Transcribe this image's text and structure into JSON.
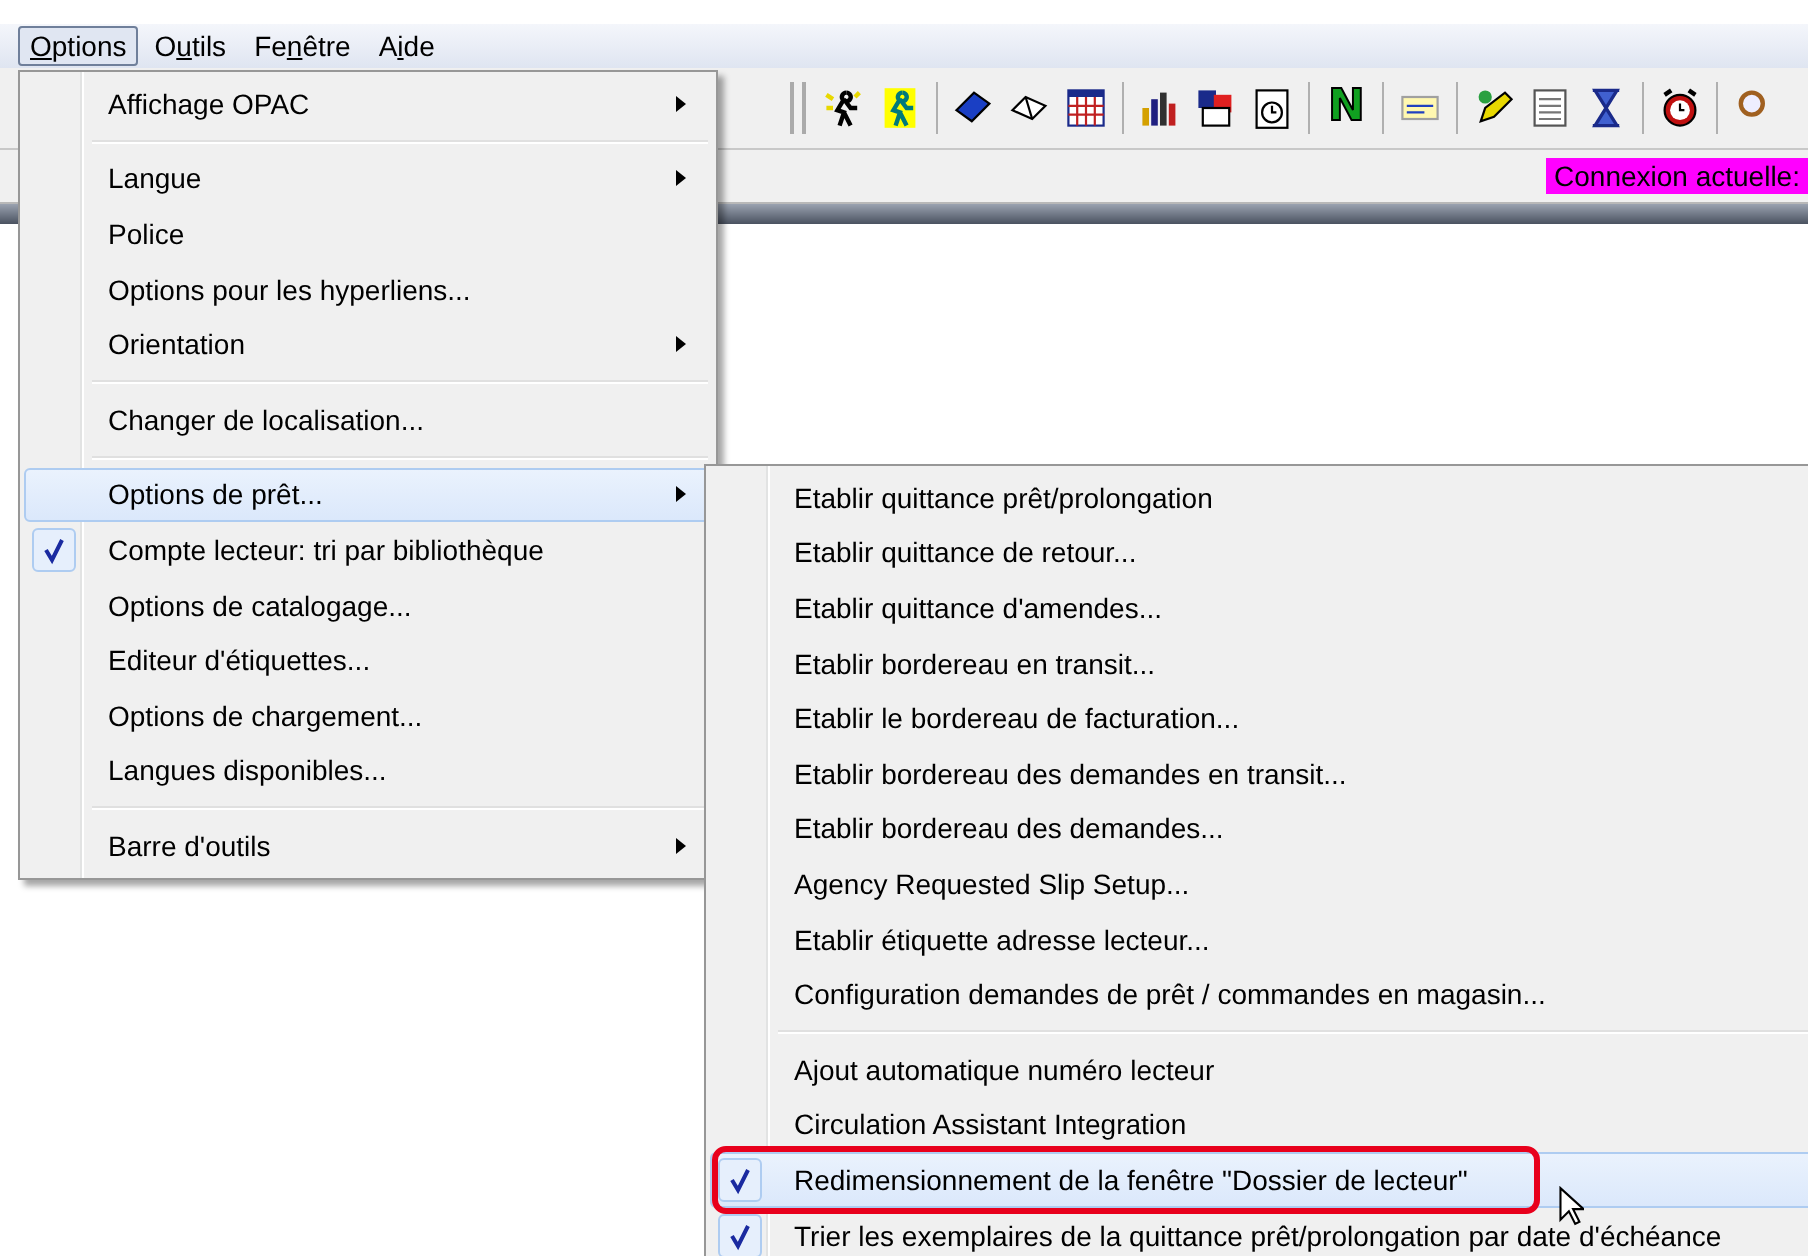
{
  "menubar": [
    {
      "access_key": "O",
      "after": "ptions",
      "selected": true
    },
    {
      "before": "O",
      "access_key": "u",
      "after": "tils",
      "selected": false
    },
    {
      "before": "Fe",
      "access_key": "n",
      "after": "être",
      "selected": false
    },
    {
      "before": "A",
      "access_key": "i",
      "after": "de",
      "selected": false
    }
  ],
  "toolbar": {
    "letter_button": "N"
  },
  "connection_label": "Connexion actuelle:",
  "options_menu": [
    {
      "kind": "item",
      "label": "Affichage OPAC",
      "submenu": true,
      "checked": false,
      "selected": false
    },
    {
      "kind": "separator"
    },
    {
      "kind": "item",
      "label": "Langue",
      "submenu": true,
      "checked": false,
      "selected": false
    },
    {
      "kind": "item",
      "label": "Police",
      "submenu": false,
      "checked": false,
      "selected": false
    },
    {
      "kind": "item",
      "label": "Options pour les hyperliens...",
      "submenu": false,
      "checked": false,
      "selected": false
    },
    {
      "kind": "item",
      "label": "Orientation",
      "submenu": true,
      "checked": false,
      "selected": false
    },
    {
      "kind": "separator"
    },
    {
      "kind": "item",
      "label": "Changer de localisation...",
      "submenu": false,
      "checked": false,
      "selected": false
    },
    {
      "kind": "separator"
    },
    {
      "kind": "item",
      "label": "Options de prêt...",
      "submenu": true,
      "checked": false,
      "selected": true
    },
    {
      "kind": "item",
      "label": "Compte lecteur: tri par bibliothèque",
      "submenu": false,
      "checked": true,
      "selected": false
    },
    {
      "kind": "item",
      "label": "Options de catalogage...",
      "submenu": false,
      "checked": false,
      "selected": false
    },
    {
      "kind": "item",
      "label": "Editeur d'étiquettes...",
      "submenu": false,
      "checked": false,
      "selected": false
    },
    {
      "kind": "item",
      "label": "Options de chargement...",
      "submenu": false,
      "checked": false,
      "selected": false
    },
    {
      "kind": "item",
      "label": "Langues disponibles...",
      "submenu": false,
      "checked": false,
      "selected": false
    },
    {
      "kind": "separator"
    },
    {
      "kind": "item",
      "label": "Barre d'outils",
      "submenu": true,
      "checked": false,
      "selected": false
    }
  ],
  "loan_submenu": [
    {
      "kind": "item",
      "label": "Etablir quittance prêt/prolongation",
      "checked": false,
      "selected": false,
      "highlighted": false
    },
    {
      "kind": "item",
      "label": "Etablir quittance de retour...",
      "checked": false,
      "selected": false,
      "highlighted": false
    },
    {
      "kind": "item",
      "label": "Etablir quittance d'amendes...",
      "checked": false,
      "selected": false,
      "highlighted": false
    },
    {
      "kind": "item",
      "label": "Etablir bordereau en transit...",
      "checked": false,
      "selected": false,
      "highlighted": false
    },
    {
      "kind": "item",
      "label": "Etablir le bordereau de facturation...",
      "checked": false,
      "selected": false,
      "highlighted": false
    },
    {
      "kind": "item",
      "label": "Etablir bordereau des demandes en transit...",
      "checked": false,
      "selected": false,
      "highlighted": false
    },
    {
      "kind": "item",
      "label": "Etablir bordereau des demandes...",
      "checked": false,
      "selected": false,
      "highlighted": false
    },
    {
      "kind": "item",
      "label": "Agency Requested Slip Setup...",
      "checked": false,
      "selected": false,
      "highlighted": false
    },
    {
      "kind": "item",
      "label": "Etablir étiquette adresse lecteur...",
      "checked": false,
      "selected": false,
      "highlighted": false
    },
    {
      "kind": "item",
      "label": "Configuration demandes de prêt / commandes en magasin...",
      "checked": false,
      "selected": false,
      "highlighted": false
    },
    {
      "kind": "separator"
    },
    {
      "kind": "item",
      "label": "Ajout automatique numéro lecteur",
      "checked": false,
      "selected": false,
      "highlighted": false
    },
    {
      "kind": "item",
      "label": "Circulation Assistant Integration",
      "checked": false,
      "selected": false,
      "highlighted": false
    },
    {
      "kind": "item",
      "label": "Redimensionnement de la fenêtre \"Dossier de lecteur\"",
      "checked": true,
      "selected": true,
      "highlighted": true
    },
    {
      "kind": "item",
      "label": "Trier les exemplaires de la quittance prêt/prolongation par date d'échéance",
      "checked": true,
      "selected": false,
      "highlighted": false
    }
  ]
}
